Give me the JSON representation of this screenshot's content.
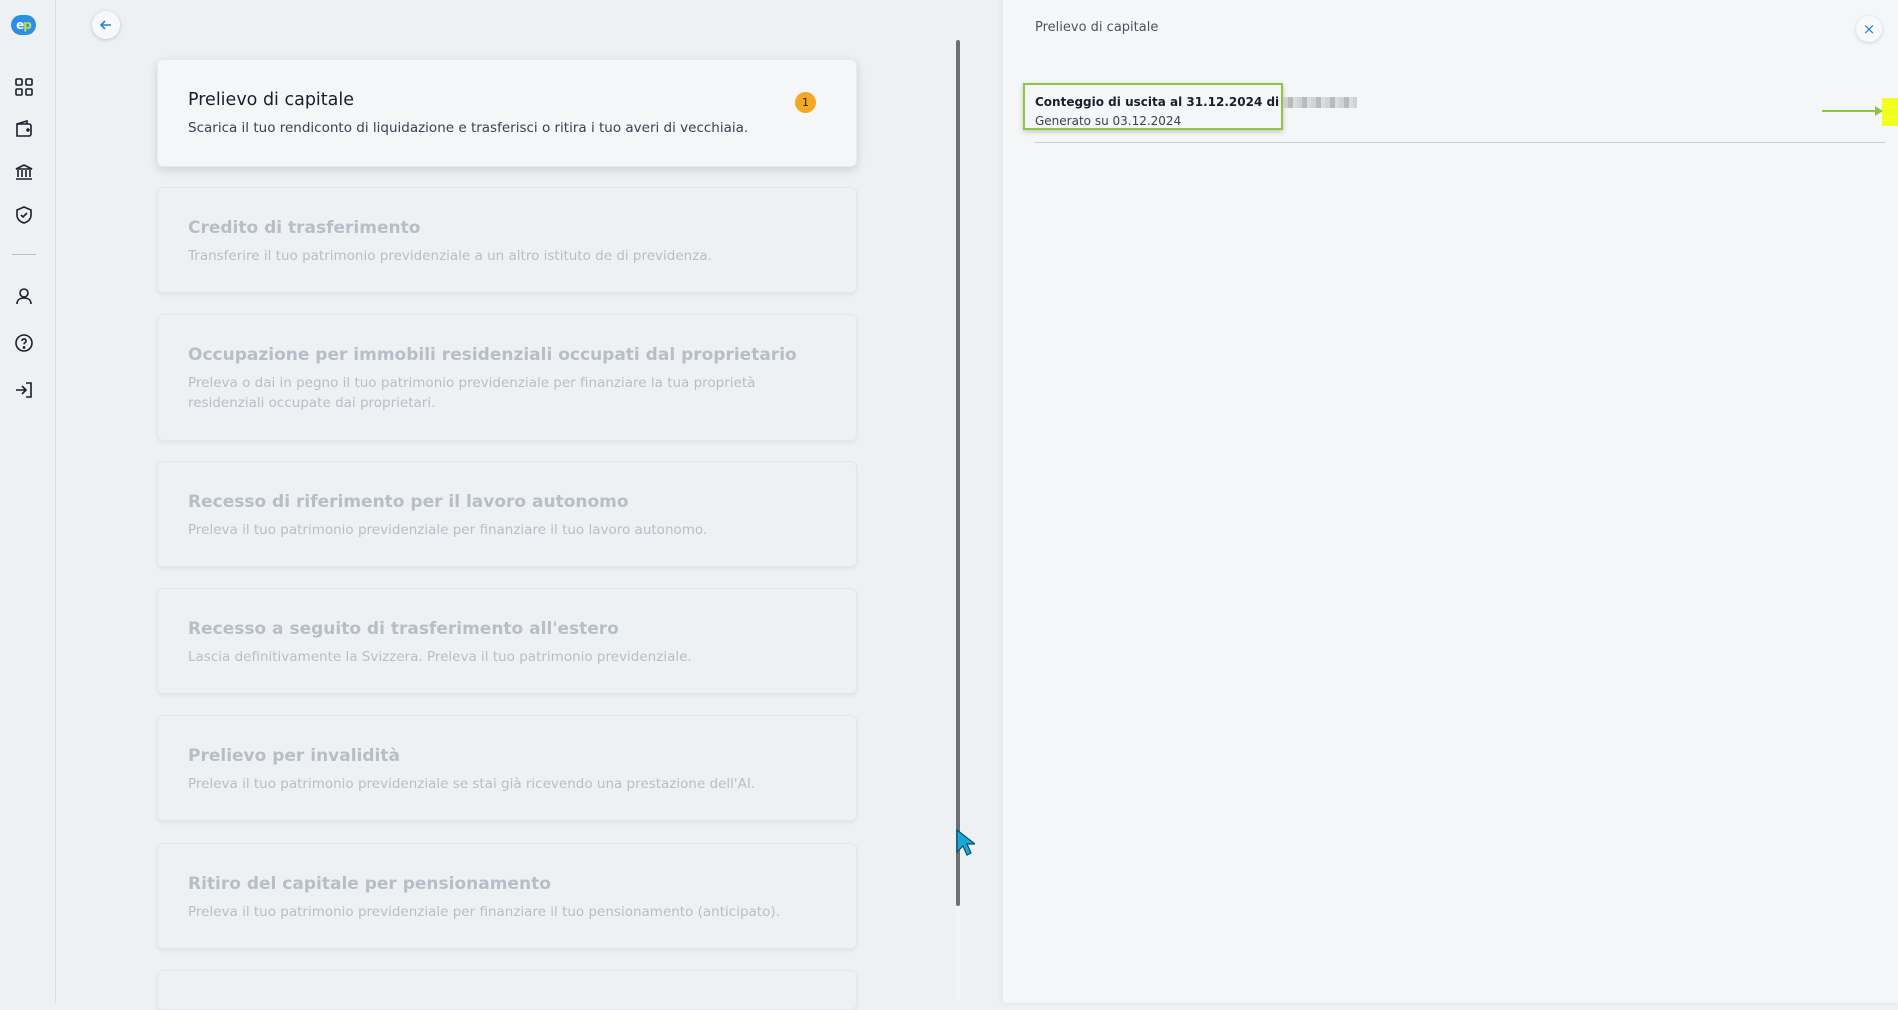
{
  "sidebar": {
    "logo_text_e": "e",
    "logo_text_p": "p",
    "items": [
      {
        "icon": "dashboard-grid-icon"
      },
      {
        "icon": "wallet-icon"
      },
      {
        "icon": "bank-icon"
      },
      {
        "icon": "shield-check-icon"
      },
      {
        "icon": "user-icon"
      },
      {
        "icon": "help-circle-icon"
      },
      {
        "icon": "logout-icon"
      }
    ]
  },
  "cards": [
    {
      "title": "Prelievo di capitale",
      "desc": "Scarica il tuo rendiconto di liquidazione e trasferisci o ritira i tuo averi di vecchiaia.",
      "badge": "1"
    },
    {
      "title": "Credito di trasferimento",
      "desc": "Transferire il tuo patrimonio previdenziale a un altro istituto de di previdenza."
    },
    {
      "title": "Occupazione per immobili residenziali occupati dal proprietario",
      "desc": "Preleva o dai in pegno il tuo patrimonio previdenziale per finanziare la tua proprietà residenziali occupate dai proprietari."
    },
    {
      "title": "Recesso di riferimento per il lavoro autonomo",
      "desc": "Preleva il tuo patrimonio previdenziale per finanziare il tuo lavoro autonomo."
    },
    {
      "title": "Recesso a seguito di trasferimento all'estero",
      "desc": "Lascia definitivamente la Svizzera. Preleva il tuo patrimonio previdenziale."
    },
    {
      "title": "Prelievo per invalidità",
      "desc": "Preleva il tuo patrimonio previdenziale se stai già ricevendo una prestazione dell'AI."
    },
    {
      "title": "Ritiro del capitale per pensionamento",
      "desc": "Preleva il tuo patrimonio previdenziale per finanziare il tuo pensionamento (anticipato)."
    }
  ],
  "panel": {
    "title": "Prelievo di capitale",
    "close_label": "×",
    "document": {
      "title": "Conteggio di uscita al 31.12.2024 di",
      "subtitle": "Generato su 03.12.2024"
    }
  },
  "colors": {
    "accent_blue": "#2d7fd8",
    "badge_orange": "#f5a623",
    "highlight_green": "#8ec63f",
    "highlight_yellow": "#f2ff1e"
  }
}
